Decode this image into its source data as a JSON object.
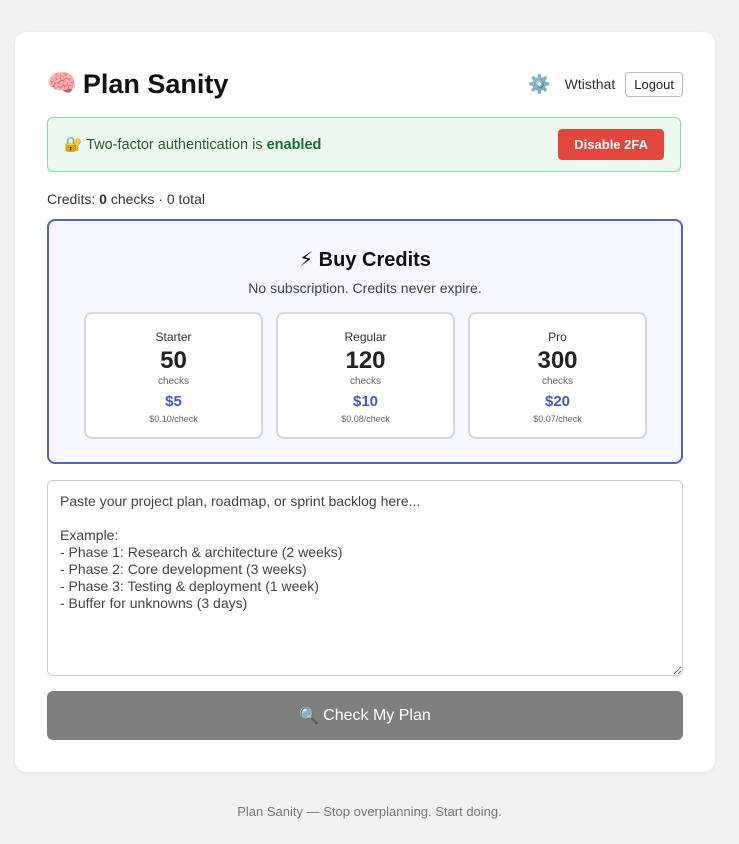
{
  "header": {
    "brand_icon": "🧠",
    "title": "Plan Sanity",
    "settings_icon": "⚙️",
    "username": "Wtisthat",
    "logout_label": "Logout"
  },
  "twofa": {
    "icon": "🔐",
    "prefix": "Two-factor authentication is",
    "status": "enabled",
    "disable_label": "Disable 2FA"
  },
  "credits": {
    "label": "Credits:",
    "checks": "0",
    "checks_unit": "checks ·",
    "total": "0 total"
  },
  "buy": {
    "icon": "⚡",
    "title": "Buy Credits",
    "subtitle": "No subscription. Credits never expire.",
    "packs": [
      {
        "name": "Starter",
        "count": "50",
        "unit": "checks",
        "price": "$5",
        "per": "$0.10/check"
      },
      {
        "name": "Regular",
        "count": "120",
        "unit": "checks",
        "price": "$10",
        "per": "$0.08/check"
      },
      {
        "name": "Pro",
        "count": "300",
        "unit": "checks",
        "price": "$20",
        "per": "$0.07/check"
      }
    ]
  },
  "plan_input": {
    "placeholder": "Paste your project plan, roadmap, or sprint backlog here...\n\nExample:\n- Phase 1: Research & architecture (2 weeks)\n- Phase 2: Core development (3 weeks)\n- Phase 3: Testing & deployment (1 week)\n- Buffer for unknowns (3 days)",
    "value": ""
  },
  "check_button": {
    "icon": "🔍",
    "label": "Check My Plan"
  },
  "footer": {
    "text": "Plan Sanity — Stop overplanning. Start doing."
  },
  "colors": {
    "accent": "#5560c2",
    "danger": "#e3463a",
    "success_bg": "#edfaf0",
    "button_disabled": "#7f7f7f"
  }
}
